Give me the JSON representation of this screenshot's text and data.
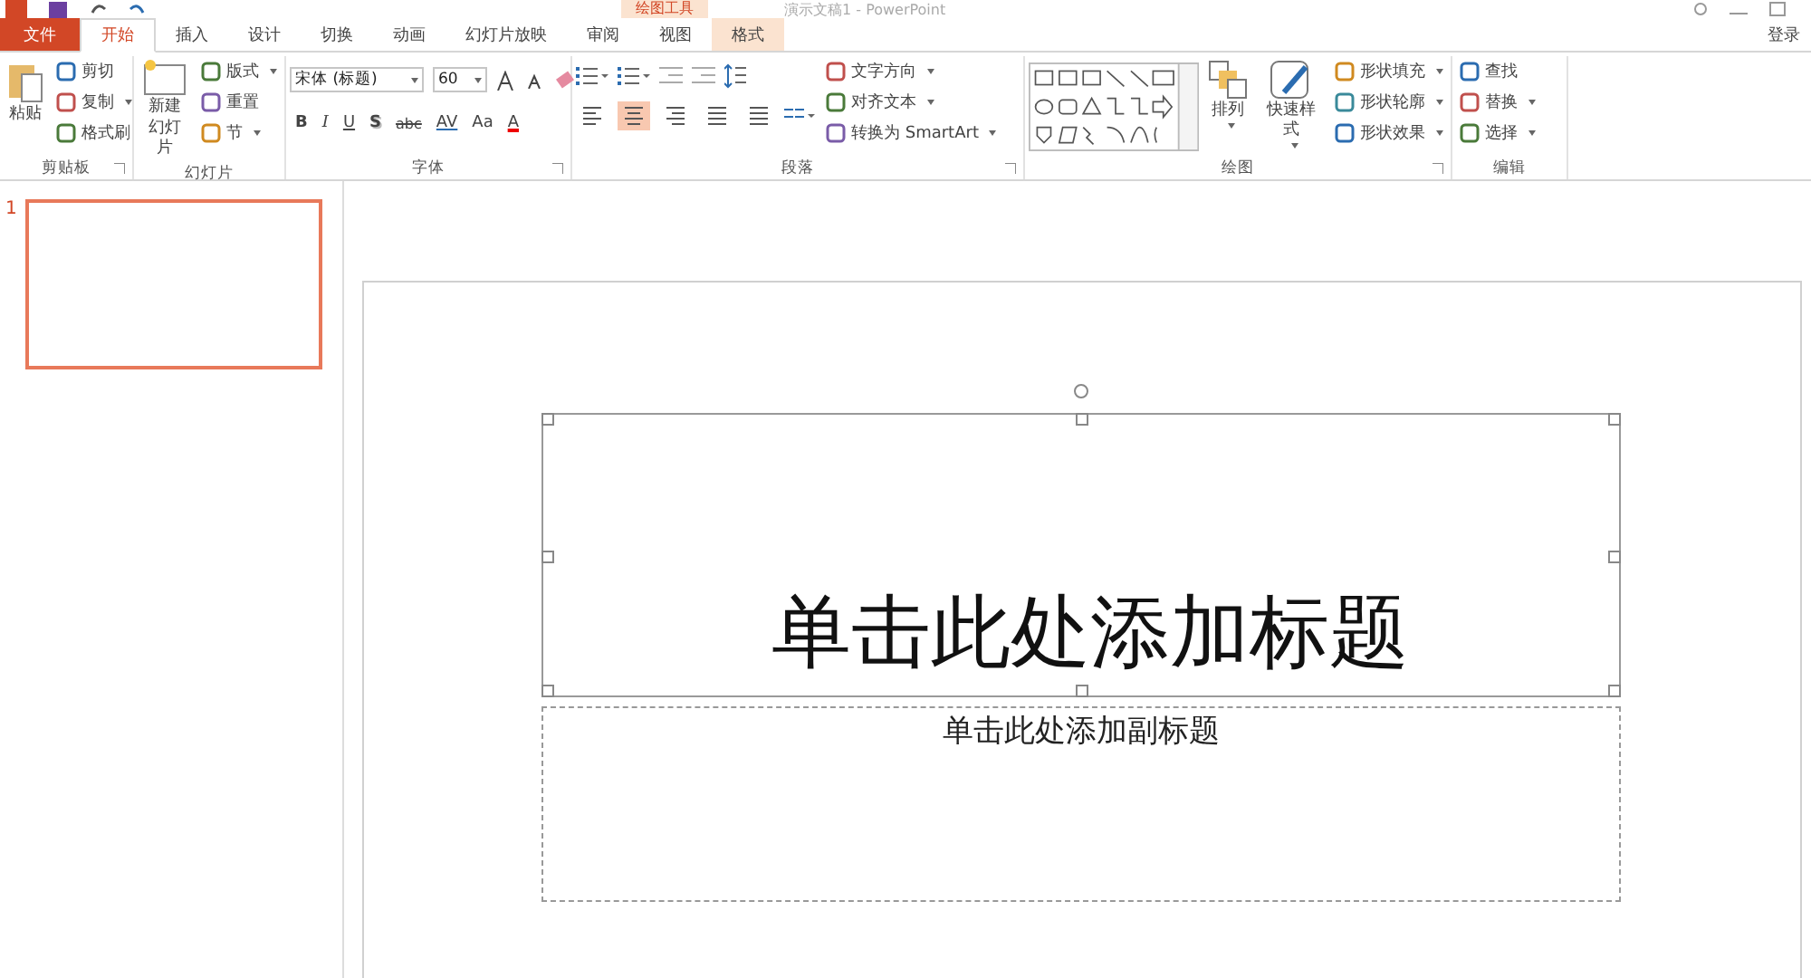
{
  "title_bar": {
    "context_group": "绘图工具",
    "document": "演示文稿1 - PowerPoint"
  },
  "tabs": [
    {
      "label": "文件",
      "kind": "file",
      "selected": false
    },
    {
      "label": "开始",
      "kind": "normal",
      "selected": true
    },
    {
      "label": "插入",
      "kind": "normal",
      "selected": false
    },
    {
      "label": "设计",
      "kind": "normal",
      "selected": false
    },
    {
      "label": "切换",
      "kind": "normal",
      "selected": false
    },
    {
      "label": "动画",
      "kind": "normal",
      "selected": false
    },
    {
      "label": "幻灯片放映",
      "kind": "normal",
      "selected": false
    },
    {
      "label": "审阅",
      "kind": "normal",
      "selected": false
    },
    {
      "label": "视图",
      "kind": "normal",
      "selected": false
    },
    {
      "label": "格式",
      "kind": "context",
      "selected": false
    }
  ],
  "sign_in": "登录",
  "ribbon": {
    "clipboard": {
      "label": "剪贴板",
      "paste": "粘贴",
      "items": [
        {
          "label": "剪切",
          "dropdown": false
        },
        {
          "label": "复制",
          "dropdown": true
        },
        {
          "label": "格式刷",
          "dropdown": false
        }
      ]
    },
    "slides": {
      "label": "幻灯片",
      "new_slide": [
        "新建",
        "幻灯片"
      ],
      "items": [
        {
          "label": "版式",
          "dropdown": true
        },
        {
          "label": "重置",
          "dropdown": false
        },
        {
          "label": "节",
          "dropdown": true
        }
      ]
    },
    "font": {
      "label": "字体",
      "font_name": "宋体 (标题)",
      "font_size": "60",
      "format_buttons": [
        {
          "label": "B",
          "kind": "bold"
        },
        {
          "label": "I",
          "kind": "italic"
        },
        {
          "label": "U",
          "kind": "underline"
        },
        {
          "label": "S",
          "kind": "shadow"
        },
        {
          "label": "abc",
          "kind": "strike"
        },
        {
          "label": "AV",
          "kind": "spacing"
        },
        {
          "label": "Aa",
          "kind": "case"
        },
        {
          "label": "A",
          "kind": "color"
        }
      ]
    },
    "paragraph": {
      "label": "段落",
      "align_buttons": [
        {
          "selected": false
        },
        {
          "selected": true
        },
        {
          "selected": false
        },
        {
          "selected": false
        },
        {
          "selected": false
        }
      ],
      "items": [
        {
          "label": "文字方向",
          "dropdown": true
        },
        {
          "label": "对齐文本",
          "dropdown": true
        },
        {
          "label": "转换为 SmartArt",
          "dropdown": true
        }
      ]
    },
    "drawing": {
      "label": "绘图",
      "arrange": "排列",
      "quick_styles": "快速样式",
      "items": [
        {
          "label": "形状填充",
          "dropdown": true
        },
        {
          "label": "形状轮廓",
          "dropdown": true
        },
        {
          "label": "形状效果",
          "dropdown": true
        }
      ]
    },
    "editing": {
      "label": "编辑",
      "items": [
        {
          "label": "查找",
          "dropdown": false
        },
        {
          "label": "替换",
          "dropdown": true
        },
        {
          "label": "选择",
          "dropdown": true
        }
      ]
    }
  },
  "slides_pane": [
    {
      "number": "1",
      "selected": true
    }
  ],
  "slide": {
    "title": {
      "placeholder": "单击此处添加标题",
      "selected": true
    },
    "subtitle": {
      "placeholder": "单击此处添加副标题",
      "selected": false
    }
  }
}
